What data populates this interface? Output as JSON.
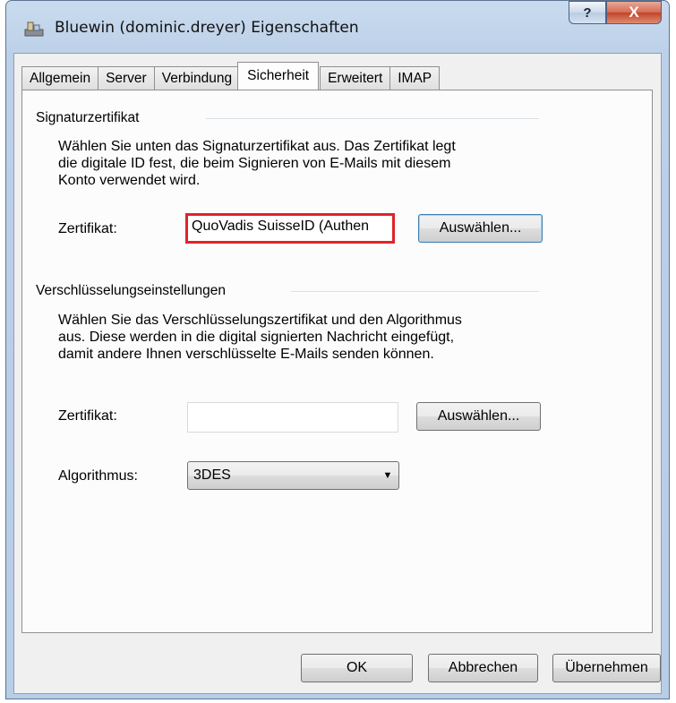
{
  "window": {
    "title": "Bluewin (dominic.dreyer) Eigenschaften",
    "help_glyph": "?",
    "close_glyph": "X"
  },
  "tabs": [
    {
      "label": "Allgemein"
    },
    {
      "label": "Server"
    },
    {
      "label": "Verbindung"
    },
    {
      "label": "Sicherheit",
      "active": true
    },
    {
      "label": "Erweitert"
    },
    {
      "label": "IMAP"
    }
  ],
  "signatur": {
    "group_title": "Signaturzertifikat",
    "description": [
      "Wählen Sie unten das Signaturzertifikat aus. Das Zertifikat legt",
      "die digitale ID fest, die beim Signieren von E-Mails mit diesem",
      "Konto verwendet wird."
    ],
    "cert_label": "Zertifikat:",
    "cert_value": "QuoVadis SuisseID (Authen",
    "select_button": "Auswählen..."
  },
  "verschluesselung": {
    "group_title": "Verschlüsselungseinstellungen",
    "description": [
      "Wählen Sie das Verschlüsselungszertifikat und den Algorithmus",
      "aus. Diese werden in die digital signierten Nachricht eingefügt,",
      "damit andere Ihnen verschlüsselte E-Mails senden können."
    ],
    "cert_label": "Zertifikat:",
    "cert_value": "",
    "select_button": "Auswählen...",
    "algo_label": "Algorithmus:",
    "algo_value": "3DES"
  },
  "footer": {
    "ok": "OK",
    "cancel": "Abbrechen",
    "apply": "Übernehmen"
  },
  "colors": {
    "highlight": "#e0232b",
    "close_button": "#c1452a"
  }
}
